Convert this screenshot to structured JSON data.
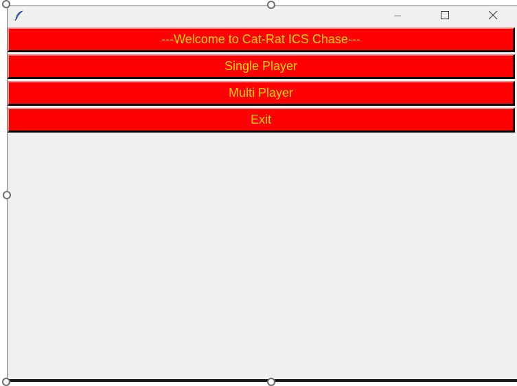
{
  "window": {
    "icon": "feather-icon",
    "controls": {
      "minimize_icon": "minimize-icon",
      "maximize_icon": "maximize-icon",
      "close_icon": "close-icon"
    }
  },
  "menu": {
    "title": "---Welcome to Cat-Rat ICS Chase---",
    "single_player": "Single Player",
    "multi_player": "Multi Player",
    "exit": "Exit"
  },
  "colors": {
    "button_bg": "#ff0000",
    "button_text": "#ffd700",
    "window_bg": "#f0f0f0"
  }
}
